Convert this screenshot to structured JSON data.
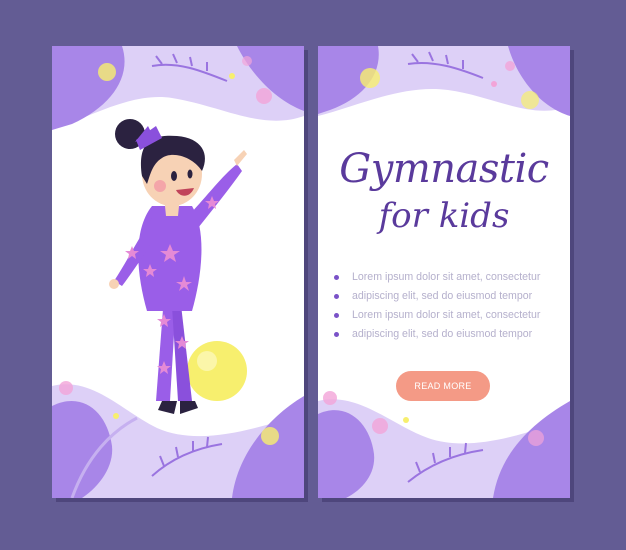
{
  "banner": {
    "title_line1": "Gymnastic",
    "title_line2": "for kids",
    "bullets": [
      "Lorem ipsum dolor sit amet, consectetur",
      "adipiscing elit, sed do eiusmod tempor",
      "Lorem ipsum dolor sit amet, consectetur",
      "adipiscing elit, sed do eiusmod tempor"
    ],
    "button_label": "READ MORE"
  },
  "colors": {
    "background": "#635c94",
    "card": "#ffffff",
    "title": "#5a3a9c",
    "bullet_dot": "#7a52c8",
    "body_text": "#b5b0cc",
    "button": "#f49a86",
    "leaf_light": "#cdbcf2",
    "leaf_dark": "#9a74e0",
    "leotard": "#9a5ee8",
    "stars": "#e58ad6",
    "ball": "#f7ef6e"
  }
}
